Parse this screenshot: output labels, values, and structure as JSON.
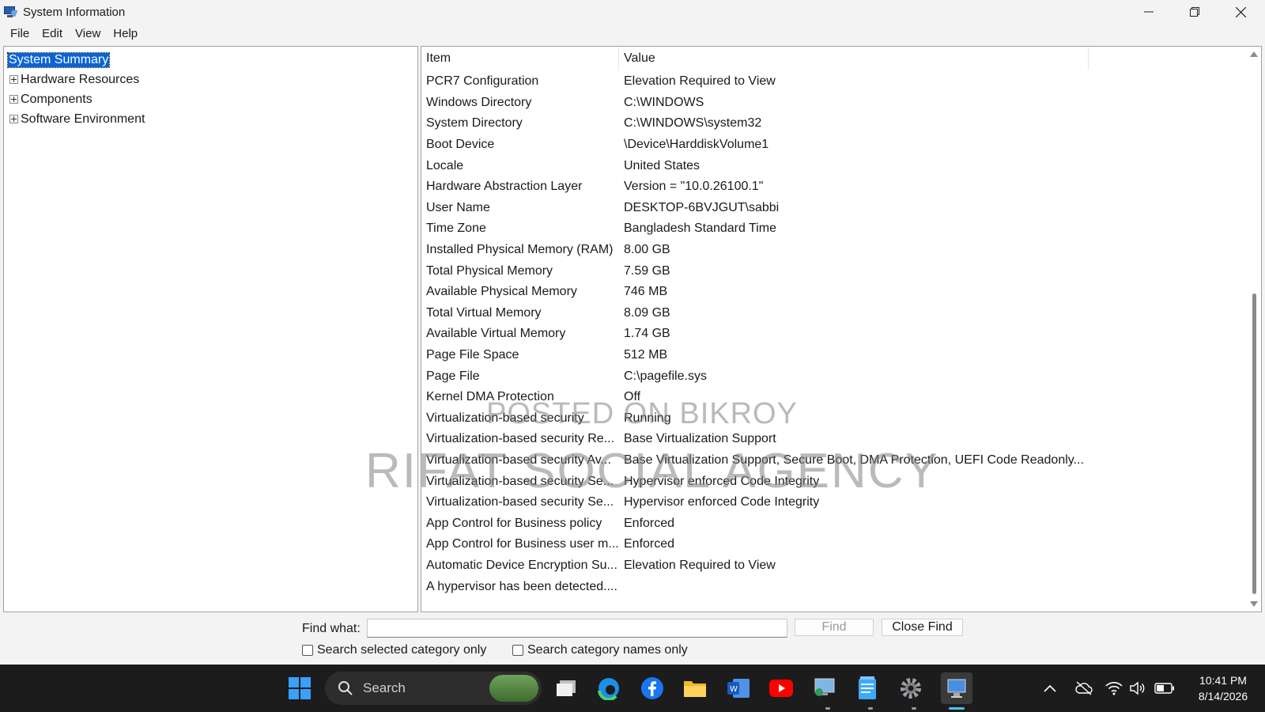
{
  "window": {
    "title": "System Information"
  },
  "menu": {
    "items": [
      "File",
      "Edit",
      "View",
      "Help"
    ]
  },
  "tree": {
    "selected": "System Summary",
    "children": [
      "Hardware Resources",
      "Components",
      "Software Environment"
    ]
  },
  "list": {
    "columns": {
      "item": "Item",
      "value": "Value"
    },
    "rows": [
      {
        "item": "PCR7 Configuration",
        "value": "Elevation Required to View"
      },
      {
        "item": "Windows Directory",
        "value": "C:\\WINDOWS"
      },
      {
        "item": "System Directory",
        "value": "C:\\WINDOWS\\system32"
      },
      {
        "item": "Boot Device",
        "value": "\\Device\\HarddiskVolume1"
      },
      {
        "item": "Locale",
        "value": "United States"
      },
      {
        "item": "Hardware Abstraction Layer",
        "value": "Version = \"10.0.26100.1\""
      },
      {
        "item": "User Name",
        "value": "DESKTOP-6BVJGUT\\sabbi"
      },
      {
        "item": "Time Zone",
        "value": "Bangladesh Standard Time"
      },
      {
        "item": "Installed Physical Memory (RAM)",
        "value": "8.00 GB"
      },
      {
        "item": "Total Physical Memory",
        "value": "7.59 GB"
      },
      {
        "item": "Available Physical Memory",
        "value": "746 MB"
      },
      {
        "item": "Total Virtual Memory",
        "value": "8.09 GB"
      },
      {
        "item": "Available Virtual Memory",
        "value": "1.74 GB"
      },
      {
        "item": "Page File Space",
        "value": "512 MB"
      },
      {
        "item": "Page File",
        "value": "C:\\pagefile.sys"
      },
      {
        "item": "Kernel DMA Protection",
        "value": "Off"
      },
      {
        "item": "Virtualization-based security",
        "value": "Running"
      },
      {
        "item": "Virtualization-based security Re...",
        "value": "Base Virtualization Support"
      },
      {
        "item": "Virtualization-based security Av...",
        "value": "Base Virtualization Support, Secure Boot, DMA Protection, UEFI Code Readonly..."
      },
      {
        "item": "Virtualization-based security Se...",
        "value": "Hypervisor enforced Code Integrity"
      },
      {
        "item": "Virtualization-based security Se...",
        "value": "Hypervisor enforced Code Integrity"
      },
      {
        "item": "App Control for Business policy",
        "value": "Enforced"
      },
      {
        "item": "App Control for Business user m...",
        "value": "Enforced"
      },
      {
        "item": "Automatic Device Encryption Su...",
        "value": "Elevation Required to View"
      },
      {
        "item": "A hypervisor has been detected....",
        "value": ""
      }
    ]
  },
  "watermark": {
    "line1": "POSTED ON BIKROY",
    "line2": "RIFAT SOCIAL AGENCY"
  },
  "find": {
    "label": "Find what:",
    "value": "",
    "find_button": "Find",
    "close_button": "Close Find",
    "option1": "Search selected category only",
    "option2": "Search category names only"
  },
  "taskbar": {
    "search_label": "Search",
    "time": "10:41 PM",
    "date": "8/14/2026"
  },
  "colors": {
    "selection": "#0a64d6",
    "taskbar": "#1c1c1c",
    "start_accent": "#3aa0ff"
  }
}
